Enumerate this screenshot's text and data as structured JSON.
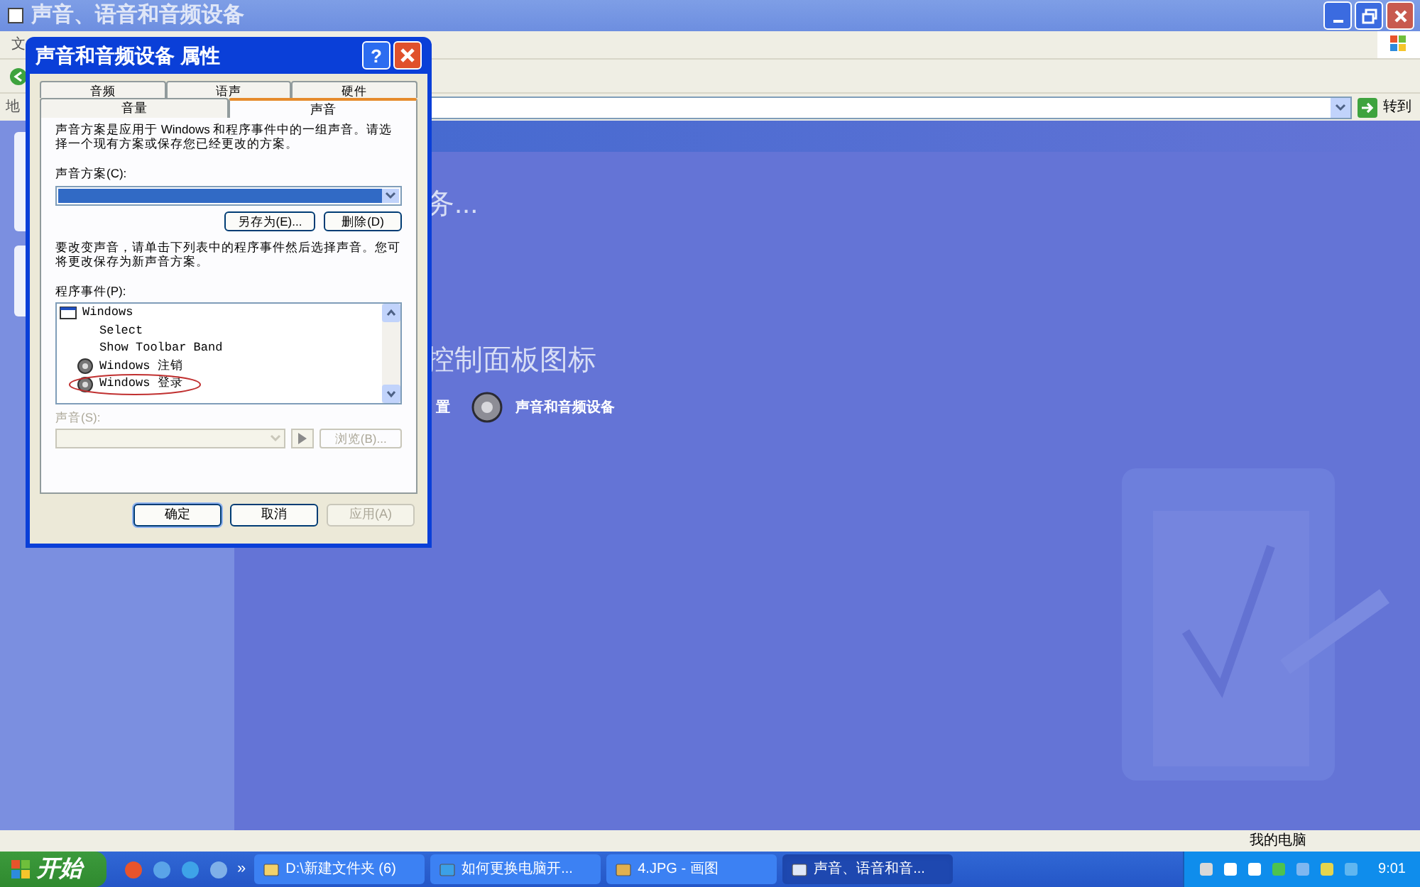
{
  "window": {
    "title": "声音、语音和音频设备"
  },
  "menu_bar": {
    "first_item": "文"
  },
  "address_bar": {
    "label": "地",
    "go_button": "转到"
  },
  "content": {
    "heading_1": "务...",
    "heading_2": "控制面板图标",
    "link_1": "置",
    "link_2": "声音和音频设备"
  },
  "status_bar": {
    "location": "我的电脑"
  },
  "dialog": {
    "title": "声音和音频设备 属性",
    "help_button": "?",
    "tabs_back": [
      {
        "label": "音频",
        "selected": false
      },
      {
        "label": "语声",
        "selected": false
      },
      {
        "label": "硬件",
        "selected": false
      }
    ],
    "tabs_front": [
      {
        "label": "音量",
        "selected": false
      },
      {
        "label": "声音",
        "selected": true
      }
    ],
    "description": "声音方案是应用于 Windows 和程序事件中的一组声音。请选择一个现有方案或保存您已经更改的方案。",
    "scheme_label": "声音方案(C):",
    "scheme_buttons": [
      {
        "label": "另存为(E)..."
      },
      {
        "label": "删除(D)"
      }
    ],
    "instructions": "要改变声音，请单击下列表中的程序事件然后选择声音。您可将更改保存为新声音方案。",
    "events_label": "程序事件(P):",
    "events": [
      {
        "label": "Windows",
        "kind": "group",
        "children": [
          {
            "label": "Select",
            "kind": "plain",
            "circled": false
          },
          {
            "label": "Show Toolbar Band",
            "kind": "plain",
            "circled": false
          },
          {
            "label": "Windows 注销",
            "kind": "sound",
            "circled": false
          },
          {
            "label": "Windows 登录",
            "kind": "sound",
            "circled": true
          }
        ]
      }
    ],
    "sound_label": {
      "text": "声音(S):",
      "disabled": true
    },
    "browse_button": {
      "label": "浏览(B)...",
      "disabled": true
    },
    "buttons": [
      {
        "label": "确定",
        "disabled": false,
        "default": true
      },
      {
        "label": "取消",
        "disabled": false,
        "default": false
      },
      {
        "label": "应用(A)",
        "disabled": true,
        "default": false
      }
    ]
  },
  "taskbar": {
    "start": "开始",
    "chevron": "»",
    "tasks": [
      {
        "label": "D:\\新建文件夹 (6)",
        "selected": false,
        "kind": "folder"
      },
      {
        "label": "如何更换电脑开...",
        "selected": false,
        "kind": "browser"
      },
      {
        "label": "4.JPG - 画图",
        "selected": false,
        "kind": "paint"
      },
      {
        "label": "声音、语音和音...",
        "selected": true,
        "kind": "control"
      }
    ],
    "clock": "9:01"
  }
}
